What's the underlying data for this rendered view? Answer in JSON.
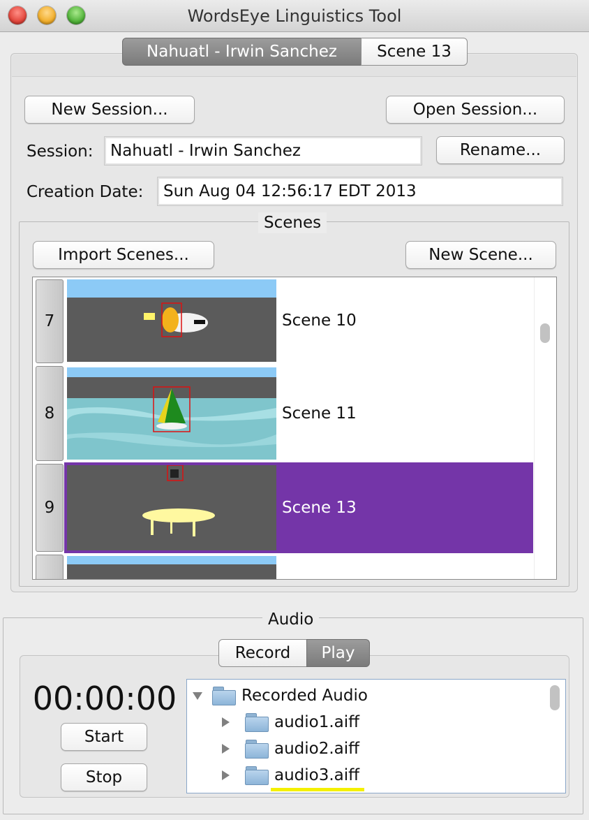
{
  "window": {
    "title": "WordsEye Linguistics Tool"
  },
  "top_tabs": [
    {
      "label": "Nahuatl - Irwin Sanchez",
      "active": true
    },
    {
      "label": "Scene 13",
      "active": false
    }
  ],
  "session": {
    "new_label": "New Session...",
    "open_label": "Open Session...",
    "session_label": "Session:",
    "session_value": "Nahuatl - Irwin Sanchez",
    "rename_label": "Rename...",
    "creation_label": "Creation Date:",
    "creation_value": "Sun Aug 04 12:56:17 EDT 2013"
  },
  "scenes": {
    "legend": "Scenes",
    "import_label": "Import Scenes...",
    "new_label": "New Scene...",
    "rows": [
      {
        "number": "7",
        "name": "Scene 10",
        "selected": false
      },
      {
        "number": "8",
        "name": "Scene 11",
        "selected": false
      },
      {
        "number": "9",
        "name": "Scene 13",
        "selected": true
      }
    ],
    "selection_color": "#7435a8"
  },
  "audio": {
    "legend": "Audio",
    "tabs": [
      {
        "label": "Record",
        "active": false
      },
      {
        "label": "Play",
        "active": true
      }
    ],
    "timer": "00:00:00",
    "start_label": "Start",
    "stop_label": "Stop",
    "tree": {
      "root": "Recorded Audio",
      "items": [
        "audio1.aiff",
        "audio2.aiff",
        "audio3.aiff"
      ]
    }
  }
}
